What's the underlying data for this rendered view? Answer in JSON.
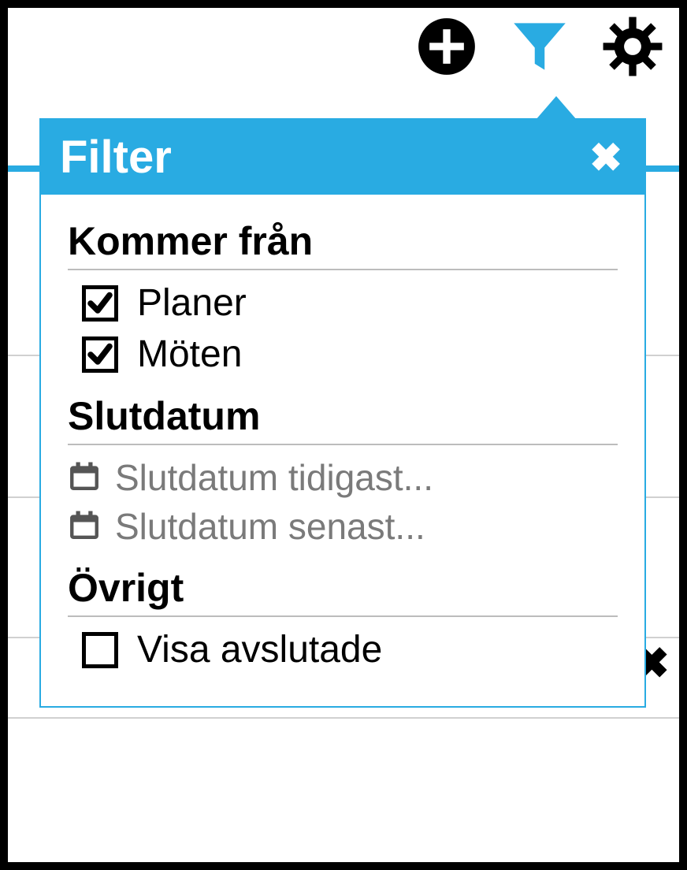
{
  "colors": {
    "accent": "#29abe2"
  },
  "toolbar": {
    "add_icon": "plus-circle",
    "filter_icon": "funnel",
    "settings_icon": "gear"
  },
  "panel": {
    "title": "Filter",
    "sections": {
      "source": {
        "title": "Kommer från",
        "options": [
          {
            "label": "Planer",
            "checked": true
          },
          {
            "label": "Möten",
            "checked": true
          }
        ]
      },
      "enddate": {
        "title": "Slutdatum",
        "fields": [
          {
            "placeholder": "Slutdatum tidigast..."
          },
          {
            "placeholder": "Slutdatum senast..."
          }
        ]
      },
      "other": {
        "title": "Övrigt",
        "options": [
          {
            "label": "Visa avslutade",
            "checked": false
          }
        ]
      }
    }
  }
}
